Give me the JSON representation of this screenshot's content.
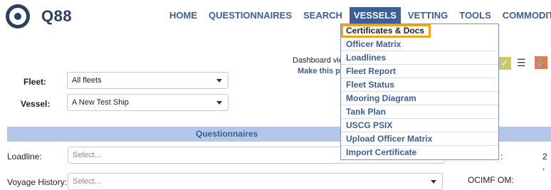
{
  "logo": {
    "text": "Q88"
  },
  "nav": [
    {
      "label": "HOME"
    },
    {
      "label": "QUESTIONNAIRES"
    },
    {
      "label": "SEARCH"
    },
    {
      "label": "VESSELS"
    },
    {
      "label": "VETTING"
    },
    {
      "label": "TOOLS"
    },
    {
      "label": "COMMODITIES"
    }
  ],
  "dashboard": {
    "line1": "Dashboard vie",
    "line2": "Make this pa"
  },
  "form": {
    "fleet_label": "Fleet:",
    "fleet_value": "All fleets",
    "vessel_label": "Vessel:",
    "vessel_value": "A New Test Ship"
  },
  "section": {
    "title": "Questionnaires"
  },
  "loadline": {
    "label": "Loadline:",
    "placeholder": "Select..."
  },
  "voyage": {
    "label": "Voyage History:",
    "placeholder": "Select..."
  },
  "right_labels": {
    "partial": ":",
    "value_partial": "2 ,",
    "ocimf": "OCIMF OM:"
  },
  "vessels_menu": [
    {
      "label": "Certificates & Docs"
    },
    {
      "label": "Officer Matrix"
    },
    {
      "label": "Loadlines"
    },
    {
      "label": "Fleet Report"
    },
    {
      "label": "Fleet Status"
    },
    {
      "label": "Mooring Diagram"
    },
    {
      "label": "Tank Plan"
    },
    {
      "label": "USCG PSIX"
    },
    {
      "label": "Upload Officer Matrix"
    },
    {
      "label": "Import Certificate"
    }
  ],
  "colors": {
    "brand": "#2b3f63",
    "nav": "#3c5f97",
    "band": "#b4c7e7",
    "highlight": "#f0a51e"
  },
  "icons": [
    "check-icon",
    "list-icon",
    "ship-icon"
  ]
}
